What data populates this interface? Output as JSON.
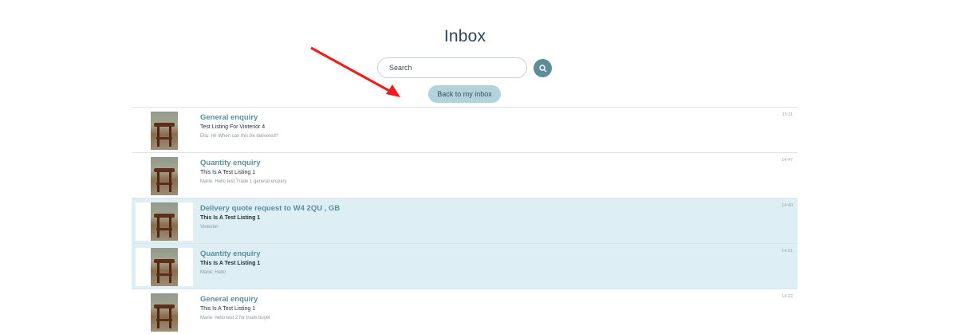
{
  "page": {
    "title": "Inbox"
  },
  "search": {
    "placeholder": "Search",
    "button_icon": "search-icon"
  },
  "back_button": {
    "label": "Back to my inbox"
  },
  "colors": {
    "accent": "#5e8c9b",
    "selected_row": "#ddeef4",
    "annotation_arrow": "#ee1c1c"
  },
  "conversations": [
    {
      "subject": "General enquiry",
      "listing": "Test Listing For Vinterior 4",
      "preview": "Ella: Hi! When can this be delivered?",
      "time": "15:11",
      "selected": false
    },
    {
      "subject": "Quantity enquiry",
      "listing": "This Is A Test Listing 1",
      "preview": "Marie: Hello test Trade 1 general enquiry",
      "time": "14:47",
      "selected": false
    },
    {
      "subject": "Delivery quote request to W4 2QU , GB",
      "listing": "This Is A Test Listing 1",
      "preview": "Vinterior:",
      "time": "14:40",
      "selected": true
    },
    {
      "subject": "Quantity enquiry",
      "listing": "This Is A Test Listing 1",
      "preview": "Marie: Hello",
      "time": "14:31",
      "selected": true
    },
    {
      "subject": "General enquiry",
      "listing": "This Is A Test Listing 1",
      "preview": "Marie: hello test 2 for trade buyer",
      "time": "14:22",
      "selected": false
    }
  ]
}
